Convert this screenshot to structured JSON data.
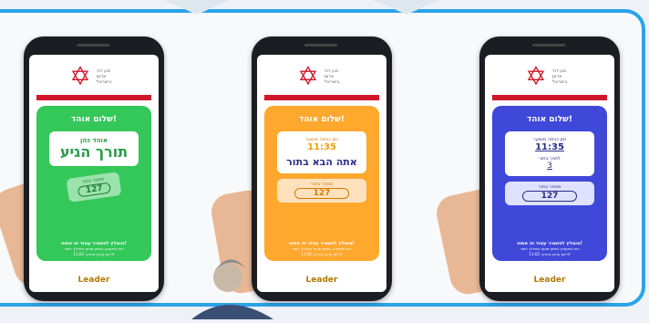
{
  "phones": [
    {
      "theme": "green",
      "card_color": "#34c759",
      "greeting": "שלום אוהד!",
      "name": "אוהד כהן",
      "headline": "תורך הגיע",
      "ticket_label": "מספר בתור",
      "ticket_number": "127",
      "bottom_main": "מומלץ להשאיר עמוד זה פתוח!",
      "bottom_sub": "הוא מתעדכן באופן שוטף במהלך התור",
      "updated": "זמן עדכון אחרון: 11:02",
      "brand": "Leader"
    },
    {
      "theme": "orange",
      "card_color": "#ffa82e",
      "greeting": "שלום אוהד!",
      "eta_label": "זמן כניסה משוער",
      "eta": "11:35",
      "headline": "אתה הבא בתור",
      "ticket_label": "מספר בתור",
      "ticket_number": "127",
      "bottom_main": "מומלץ להשאיר עמוד זה פתוח!",
      "bottom_sub": "הוא מתעדכן באופן שוטף במהלך התור",
      "updated": "זמן עדכון אחרון: 11:02",
      "brand": "Leader"
    },
    {
      "theme": "blue",
      "card_color": "#3f48d8",
      "greeting": "שלום אוהד!",
      "eta_label": "זמן כניסה משוער",
      "eta": "11:35",
      "ahead_label": "לפניך בתור",
      "ahead": "3",
      "ticket_label": "מספר בתור",
      "ticket_number": "127",
      "bottom_main": "מומלץ להשאיר עמוד זה פתוח!",
      "bottom_sub": "הוא מתעדכן באופן שוטף במהלך התור",
      "updated": "זמן עדכון אחרון: 11:02",
      "brand": "Leader"
    }
  ],
  "logo_text": "מגן דוד אדום בישראל"
}
